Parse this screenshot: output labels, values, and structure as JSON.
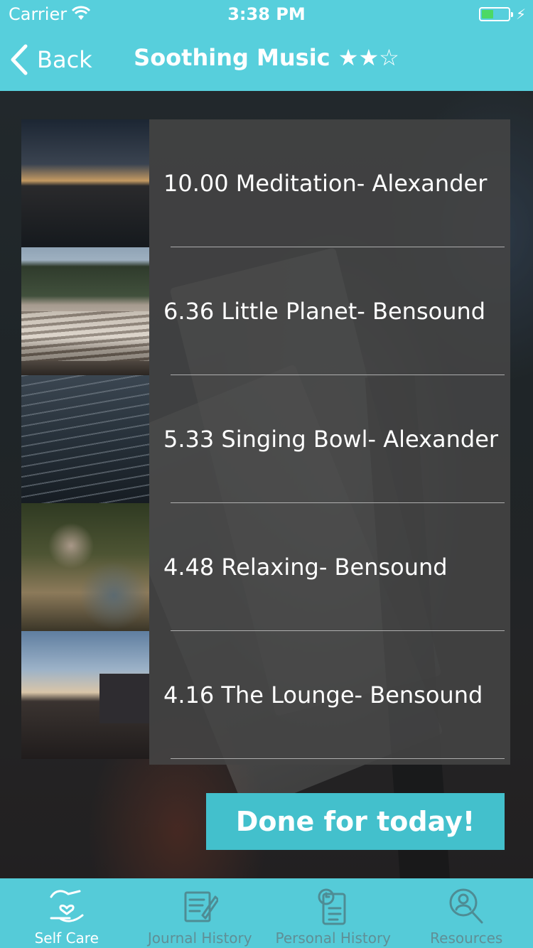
{
  "status_bar": {
    "carrier": "Carrier",
    "time": "3:38 PM"
  },
  "nav": {
    "back_label": "Back",
    "title": "Soothing Music ★★☆"
  },
  "tracks": [
    {
      "title": "10.00 Meditation- Alexander",
      "thumb": "sunset-over-water"
    },
    {
      "title": "6.36 Little Planet- Bensound",
      "thumb": "train-tracks"
    },
    {
      "title": "5.33 Singing Bowl- Alexander",
      "thumb": "ocean-waves"
    },
    {
      "title": "4.48 Relaxing- Bensound",
      "thumb": "stacked-rocks"
    },
    {
      "title": "4.16 The Lounge- Bensound",
      "thumb": "street-dusk"
    }
  ],
  "done_button": {
    "label": "Done for today!"
  },
  "tabs": [
    {
      "label": "Self Care",
      "icon": "hand-heart-icon",
      "active": true
    },
    {
      "label": "Journal History",
      "icon": "journal-pen-icon",
      "active": false
    },
    {
      "label": "Personal History",
      "icon": "clipboard-clock-icon",
      "active": false
    },
    {
      "label": "Resources",
      "icon": "magnifier-person-icon",
      "active": false
    }
  ],
  "colors": {
    "accent": "#57cfdc",
    "button": "#43c0cc",
    "tab_bar": "#55cbd8",
    "battery": "#4cd964"
  }
}
